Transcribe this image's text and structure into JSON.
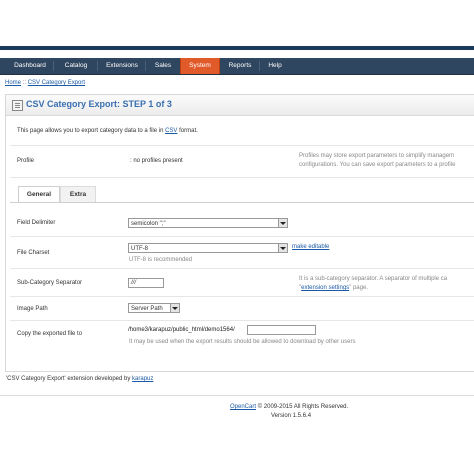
{
  "nav": {
    "items": [
      {
        "label": "Dashboard",
        "active": false
      },
      {
        "label": "Catalog",
        "active": false
      },
      {
        "label": "Extensions",
        "active": false
      },
      {
        "label": "Sales",
        "active": false
      },
      {
        "label": "System",
        "active": true
      },
      {
        "label": "Reports",
        "active": false
      },
      {
        "label": "Help",
        "active": false
      }
    ],
    "active_color": "#e05a2a"
  },
  "breadcrumb": {
    "home": "Home",
    "separator": "::",
    "current": "CSV Category Export"
  },
  "page": {
    "title": "CSV Category Export: STEP 1 of 3",
    "intro_prefix": "This page allows you to export category data to a file in",
    "intro_link": "CSV",
    "intro_suffix": "format.",
    "profile_label": "Profile",
    "profile_value": ": no profiles present",
    "profile_help_1": "Profiles may store export parameters to simplify managem",
    "profile_help_2": "configurations. You can save export parameters to a profile"
  },
  "tabs": [
    {
      "label": "General",
      "active": true
    },
    {
      "label": "Extra",
      "active": false
    }
  ],
  "form": {
    "field_delimiter": {
      "label": "Field Delimiter",
      "value": "semicolon \";\""
    },
    "file_charset": {
      "label": "File Charset",
      "value": "UTF-8",
      "link": "make editable",
      "note": "UTF-8 is recommended"
    },
    "subcategory_separator": {
      "label": "Sub-Category Separator",
      "value": "///",
      "help_1": "It is a sub-category separator. A separator of multiple ca",
      "help_2_prefix": "\"",
      "help_2_link": "extension settings",
      "help_2_suffix": "\" page."
    },
    "image_path": {
      "label": "Image Path",
      "value": "Server Path"
    },
    "copy_to": {
      "label": "Copy the exported file to",
      "value": "/home3/karapuz/public_html/demo1564/",
      "note": "It may be used when the export results should be allowed to download by other users"
    }
  },
  "extension_note": {
    "prefix": "'CSV Category Export' extension developed by",
    "link": "karapuz"
  },
  "footer": {
    "link": "OpenCart",
    "copyright": "© 2009-2015 All Rights Reserved.",
    "version": "Version 1.5.6.4"
  }
}
